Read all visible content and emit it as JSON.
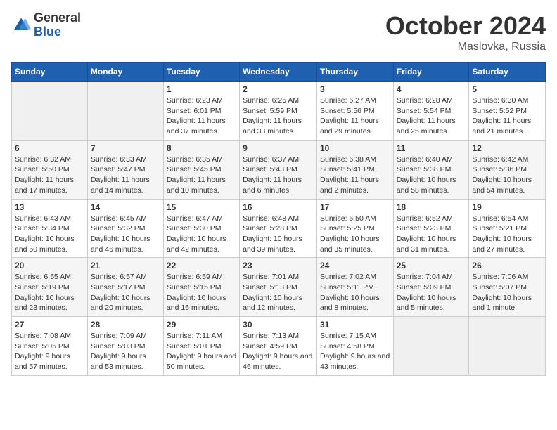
{
  "header": {
    "logo_general": "General",
    "logo_blue": "Blue",
    "month_title": "October 2024",
    "location": "Maslovka, Russia"
  },
  "weekdays": [
    "Sunday",
    "Monday",
    "Tuesday",
    "Wednesday",
    "Thursday",
    "Friday",
    "Saturday"
  ],
  "weeks": [
    [
      {
        "day": "",
        "sunrise": "",
        "sunset": "",
        "daylight": ""
      },
      {
        "day": "",
        "sunrise": "",
        "sunset": "",
        "daylight": ""
      },
      {
        "day": "1",
        "sunrise": "Sunrise: 6:23 AM",
        "sunset": "Sunset: 6:01 PM",
        "daylight": "Daylight: 11 hours and 37 minutes."
      },
      {
        "day": "2",
        "sunrise": "Sunrise: 6:25 AM",
        "sunset": "Sunset: 5:59 PM",
        "daylight": "Daylight: 11 hours and 33 minutes."
      },
      {
        "day": "3",
        "sunrise": "Sunrise: 6:27 AM",
        "sunset": "Sunset: 5:56 PM",
        "daylight": "Daylight: 11 hours and 29 minutes."
      },
      {
        "day": "4",
        "sunrise": "Sunrise: 6:28 AM",
        "sunset": "Sunset: 5:54 PM",
        "daylight": "Daylight: 11 hours and 25 minutes."
      },
      {
        "day": "5",
        "sunrise": "Sunrise: 6:30 AM",
        "sunset": "Sunset: 5:52 PM",
        "daylight": "Daylight: 11 hours and 21 minutes."
      }
    ],
    [
      {
        "day": "6",
        "sunrise": "Sunrise: 6:32 AM",
        "sunset": "Sunset: 5:50 PM",
        "daylight": "Daylight: 11 hours and 17 minutes."
      },
      {
        "day": "7",
        "sunrise": "Sunrise: 6:33 AM",
        "sunset": "Sunset: 5:47 PM",
        "daylight": "Daylight: 11 hours and 14 minutes."
      },
      {
        "day": "8",
        "sunrise": "Sunrise: 6:35 AM",
        "sunset": "Sunset: 5:45 PM",
        "daylight": "Daylight: 11 hours and 10 minutes."
      },
      {
        "day": "9",
        "sunrise": "Sunrise: 6:37 AM",
        "sunset": "Sunset: 5:43 PM",
        "daylight": "Daylight: 11 hours and 6 minutes."
      },
      {
        "day": "10",
        "sunrise": "Sunrise: 6:38 AM",
        "sunset": "Sunset: 5:41 PM",
        "daylight": "Daylight: 11 hours and 2 minutes."
      },
      {
        "day": "11",
        "sunrise": "Sunrise: 6:40 AM",
        "sunset": "Sunset: 5:38 PM",
        "daylight": "Daylight: 10 hours and 58 minutes."
      },
      {
        "day": "12",
        "sunrise": "Sunrise: 6:42 AM",
        "sunset": "Sunset: 5:36 PM",
        "daylight": "Daylight: 10 hours and 54 minutes."
      }
    ],
    [
      {
        "day": "13",
        "sunrise": "Sunrise: 6:43 AM",
        "sunset": "Sunset: 5:34 PM",
        "daylight": "Daylight: 10 hours and 50 minutes."
      },
      {
        "day": "14",
        "sunrise": "Sunrise: 6:45 AM",
        "sunset": "Sunset: 5:32 PM",
        "daylight": "Daylight: 10 hours and 46 minutes."
      },
      {
        "day": "15",
        "sunrise": "Sunrise: 6:47 AM",
        "sunset": "Sunset: 5:30 PM",
        "daylight": "Daylight: 10 hours and 42 minutes."
      },
      {
        "day": "16",
        "sunrise": "Sunrise: 6:48 AM",
        "sunset": "Sunset: 5:28 PM",
        "daylight": "Daylight: 10 hours and 39 minutes."
      },
      {
        "day": "17",
        "sunrise": "Sunrise: 6:50 AM",
        "sunset": "Sunset: 5:25 PM",
        "daylight": "Daylight: 10 hours and 35 minutes."
      },
      {
        "day": "18",
        "sunrise": "Sunrise: 6:52 AM",
        "sunset": "Sunset: 5:23 PM",
        "daylight": "Daylight: 10 hours and 31 minutes."
      },
      {
        "day": "19",
        "sunrise": "Sunrise: 6:54 AM",
        "sunset": "Sunset: 5:21 PM",
        "daylight": "Daylight: 10 hours and 27 minutes."
      }
    ],
    [
      {
        "day": "20",
        "sunrise": "Sunrise: 6:55 AM",
        "sunset": "Sunset: 5:19 PM",
        "daylight": "Daylight: 10 hours and 23 minutes."
      },
      {
        "day": "21",
        "sunrise": "Sunrise: 6:57 AM",
        "sunset": "Sunset: 5:17 PM",
        "daylight": "Daylight: 10 hours and 20 minutes."
      },
      {
        "day": "22",
        "sunrise": "Sunrise: 6:59 AM",
        "sunset": "Sunset: 5:15 PM",
        "daylight": "Daylight: 10 hours and 16 minutes."
      },
      {
        "day": "23",
        "sunrise": "Sunrise: 7:01 AM",
        "sunset": "Sunset: 5:13 PM",
        "daylight": "Daylight: 10 hours and 12 minutes."
      },
      {
        "day": "24",
        "sunrise": "Sunrise: 7:02 AM",
        "sunset": "Sunset: 5:11 PM",
        "daylight": "Daylight: 10 hours and 8 minutes."
      },
      {
        "day": "25",
        "sunrise": "Sunrise: 7:04 AM",
        "sunset": "Sunset: 5:09 PM",
        "daylight": "Daylight: 10 hours and 5 minutes."
      },
      {
        "day": "26",
        "sunrise": "Sunrise: 7:06 AM",
        "sunset": "Sunset: 5:07 PM",
        "daylight": "Daylight: 10 hours and 1 minute."
      }
    ],
    [
      {
        "day": "27",
        "sunrise": "Sunrise: 7:08 AM",
        "sunset": "Sunset: 5:05 PM",
        "daylight": "Daylight: 9 hours and 57 minutes."
      },
      {
        "day": "28",
        "sunrise": "Sunrise: 7:09 AM",
        "sunset": "Sunset: 5:03 PM",
        "daylight": "Daylight: 9 hours and 53 minutes."
      },
      {
        "day": "29",
        "sunrise": "Sunrise: 7:11 AM",
        "sunset": "Sunset: 5:01 PM",
        "daylight": "Daylight: 9 hours and 50 minutes."
      },
      {
        "day": "30",
        "sunrise": "Sunrise: 7:13 AM",
        "sunset": "Sunset: 4:59 PM",
        "daylight": "Daylight: 9 hours and 46 minutes."
      },
      {
        "day": "31",
        "sunrise": "Sunrise: 7:15 AM",
        "sunset": "Sunset: 4:58 PM",
        "daylight": "Daylight: 9 hours and 43 minutes."
      },
      {
        "day": "",
        "sunrise": "",
        "sunset": "",
        "daylight": ""
      },
      {
        "day": "",
        "sunrise": "",
        "sunset": "",
        "daylight": ""
      }
    ]
  ]
}
